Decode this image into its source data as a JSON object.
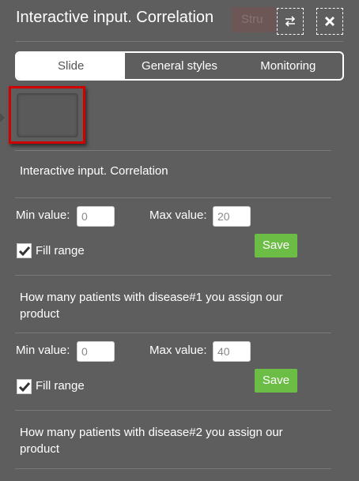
{
  "header": {
    "title": "Interactive input. Correlation",
    "hidden_button_label": "Stru",
    "swap_icon": "swap-arrows-icon",
    "close_icon": "close-icon"
  },
  "tabs": [
    {
      "label": "Slide",
      "active": true
    },
    {
      "label": "General styles",
      "active": false
    },
    {
      "label": "Monitoring",
      "active": false
    }
  ],
  "sections": [
    {
      "title": "Interactive input. Correlation",
      "min_label": "Min value:",
      "min_value": "0",
      "max_label": "Max value:",
      "max_value": "20",
      "fill_label": "Fill range",
      "fill_checked": true,
      "save_label": "Save"
    },
    {
      "title": "How many patients with disease#1 you assign our product",
      "min_label": "Min value:",
      "min_value": "0",
      "max_label": "Max value:",
      "max_value": "40",
      "fill_label": "Fill range",
      "fill_checked": true,
      "save_label": "Save"
    },
    {
      "title": "How many patients with disease#2 you assign our product"
    }
  ],
  "colors": {
    "background": "#5e5e5e",
    "save_button": "#6cbd45",
    "thumbnail_highlight": "#d10000"
  }
}
